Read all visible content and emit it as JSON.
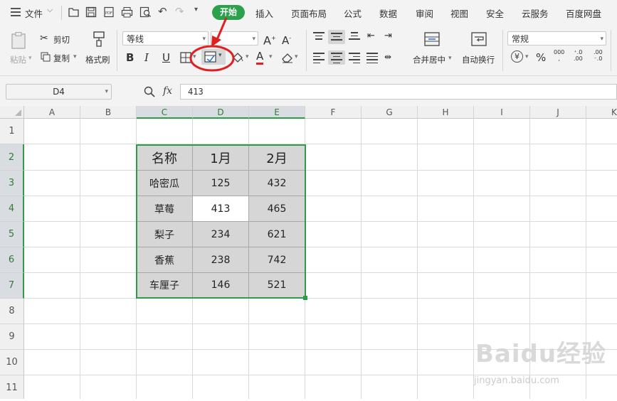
{
  "menubar": {
    "file_label": "文件",
    "tabs": [
      "开始",
      "插入",
      "页面布局",
      "公式",
      "数据",
      "审阅",
      "视图",
      "安全",
      "云服务",
      "百度网盘"
    ]
  },
  "ribbon": {
    "paste_label": "粘贴",
    "cut_label": "剪切",
    "copy_label": "复制",
    "format_painter_label": "格式刷",
    "font_name": "等线",
    "number_format": "常规",
    "merge_label": "合并居中",
    "wrap_label": "自动换行",
    "bold": "B",
    "italic": "I",
    "underline": "U"
  },
  "formula_bar": {
    "name_box": "D4",
    "fx_label": "fx",
    "value": "413"
  },
  "columns": [
    "A",
    "B",
    "C",
    "D",
    "E",
    "F",
    "G",
    "H",
    "I",
    "J",
    "K"
  ],
  "rows": [
    "1",
    "2",
    "3",
    "4",
    "5",
    "6",
    "7",
    "8",
    "9",
    "10",
    "11"
  ],
  "table": {
    "header": [
      "名称",
      "1月",
      "2月"
    ],
    "rows": [
      [
        "哈密瓜",
        "125",
        "432"
      ],
      [
        "草莓",
        "413",
        "465"
      ],
      [
        "梨子",
        "234",
        "621"
      ],
      [
        "香蕉",
        "238",
        "742"
      ],
      [
        "车厘子",
        "146",
        "521"
      ]
    ]
  },
  "watermark": {
    "text": "Baidu经验",
    "url_text": "jingyan.baidu.com"
  },
  "colors": {
    "accent_green": "#2aa14a",
    "selection_green": "#2e9b48",
    "annotation_red": "#e02020"
  }
}
